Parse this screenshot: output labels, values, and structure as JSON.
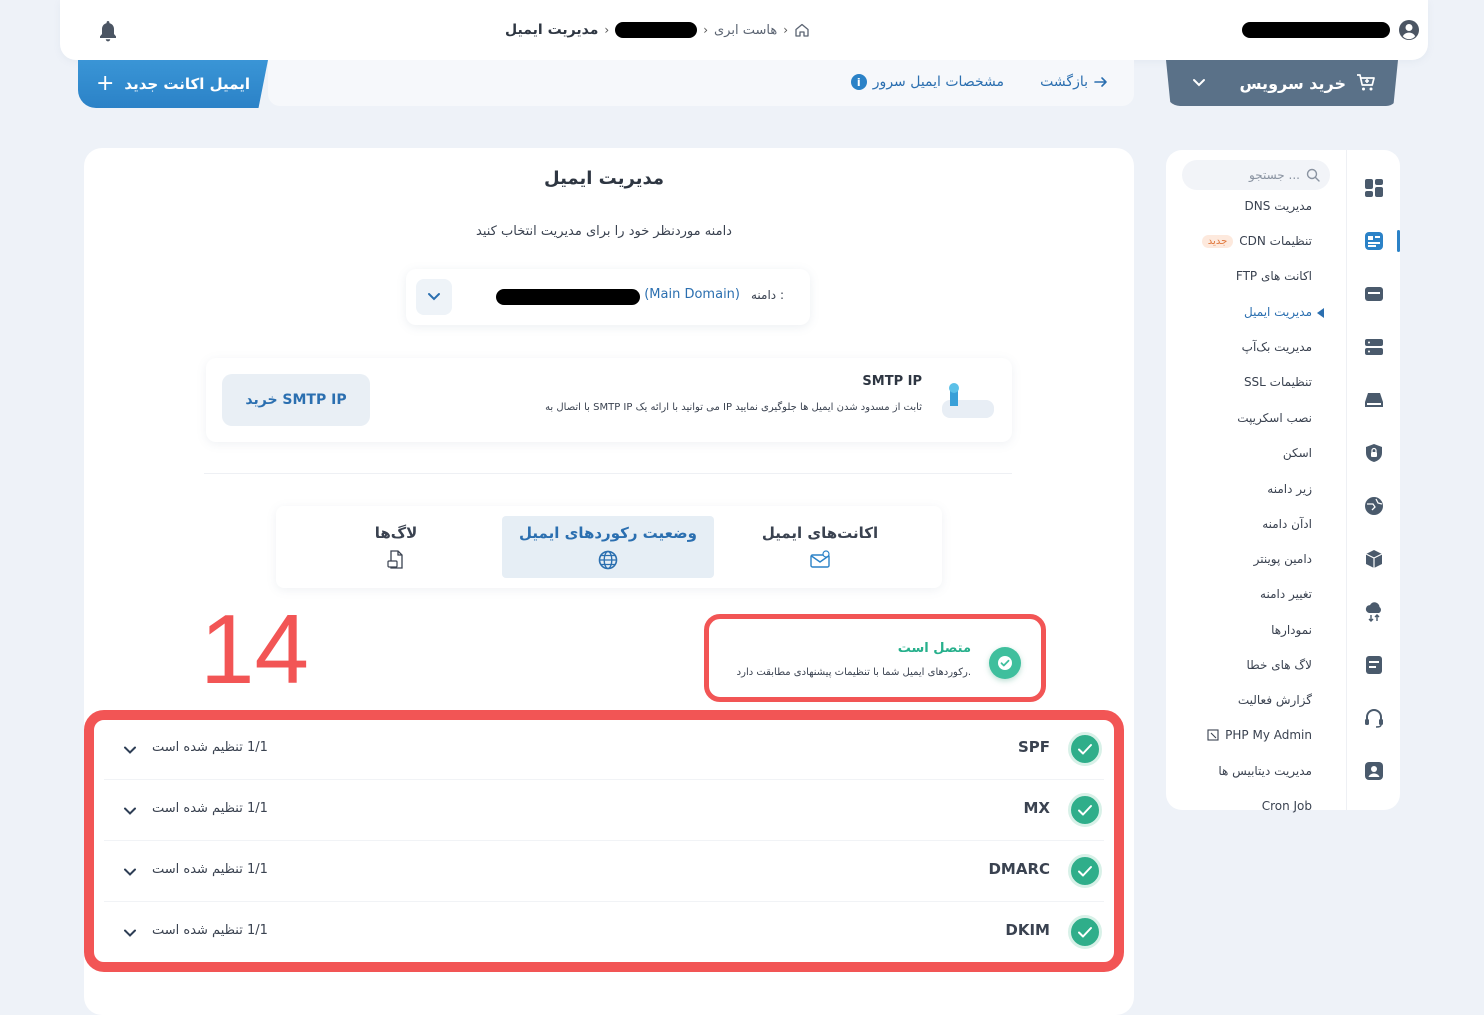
{
  "header": {
    "breadcrumb": {
      "home_icon": "home-icon",
      "cloud_host": "هاست ابری",
      "current": "مدیریت ایمیل"
    },
    "bell_icon": "bell-icon",
    "user_icon": "user-icon"
  },
  "toolbar": {
    "new_account_label": "ایمیل اکانت جدید",
    "back_label": "بازگشت",
    "server_specs_label": "مشخصات ایمیل سرور",
    "buy_service_label": "خرید سرویس"
  },
  "sidebar": {
    "search_placeholder": "جستجو ...",
    "items": [
      {
        "label": "مدیریت DNS"
      },
      {
        "label": "تنظیمات CDN",
        "badge": "جدید"
      },
      {
        "label": "اکانت های FTP"
      },
      {
        "label": "مدیریت ایمیل",
        "active": true
      },
      {
        "label": "مدیریت بک‌آپ"
      },
      {
        "label": "تنظیمات SSL"
      },
      {
        "label": "نصب اسکریپت"
      },
      {
        "label": "اسکن"
      },
      {
        "label": "زیر دامنه"
      },
      {
        "label": "ادآن دامنه"
      },
      {
        "label": "دامین پوینتر"
      },
      {
        "label": "تغییر دامنه"
      },
      {
        "label": "نمودارها"
      },
      {
        "label": "لاگ های خطا"
      },
      {
        "label": "گزارش فعالیت"
      },
      {
        "label": "PHP My Admin"
      },
      {
        "label": "مدیریت دیتابیس ها"
      },
      {
        "label": "Cron Job"
      }
    ]
  },
  "main": {
    "title": "مدیریت ایمیل",
    "subtitle": "دامنه موردنظر خود را برای مدیریت انتخاب کنید",
    "domain": {
      "label": "دامنه :",
      "main_tag": "(Main Domain)"
    },
    "smtp": {
      "title": "SMTP IP",
      "description": "با اتصال به SMTP IP می توانید با ارائه یک IP ثابت از مسدود شدن ایمیل ها جلوگیری نمایید",
      "button": "خرید SMTP IP"
    },
    "tabs": [
      {
        "label": "اکانت‌های ایمیل",
        "icon": "email-icon"
      },
      {
        "label": "وضعیت رکوردهای ایمیل",
        "icon": "globe-icon",
        "active": true
      },
      {
        "label": "لاگ‌ها",
        "icon": "document-icon"
      }
    ],
    "status": {
      "title": "متصل است",
      "description": "رکوردهای ایمیل شما با تنظیمات پیشنهادی مطابقت دارد."
    },
    "annotation_number": "14",
    "records": [
      {
        "name": "SPF",
        "status": "1/1 تنظیم شده است"
      },
      {
        "name": "MX",
        "status": "1/1 تنظیم شده است"
      },
      {
        "name": "DMARC",
        "status": "1/1 تنظیم شده است"
      },
      {
        "name": "DKIM",
        "status": "1/1 تنظیم شده است"
      }
    ]
  },
  "colors": {
    "accent": "#2b82c7",
    "success": "#2fae8a",
    "highlight": "#f25555",
    "buy_button": "#5a7188"
  }
}
